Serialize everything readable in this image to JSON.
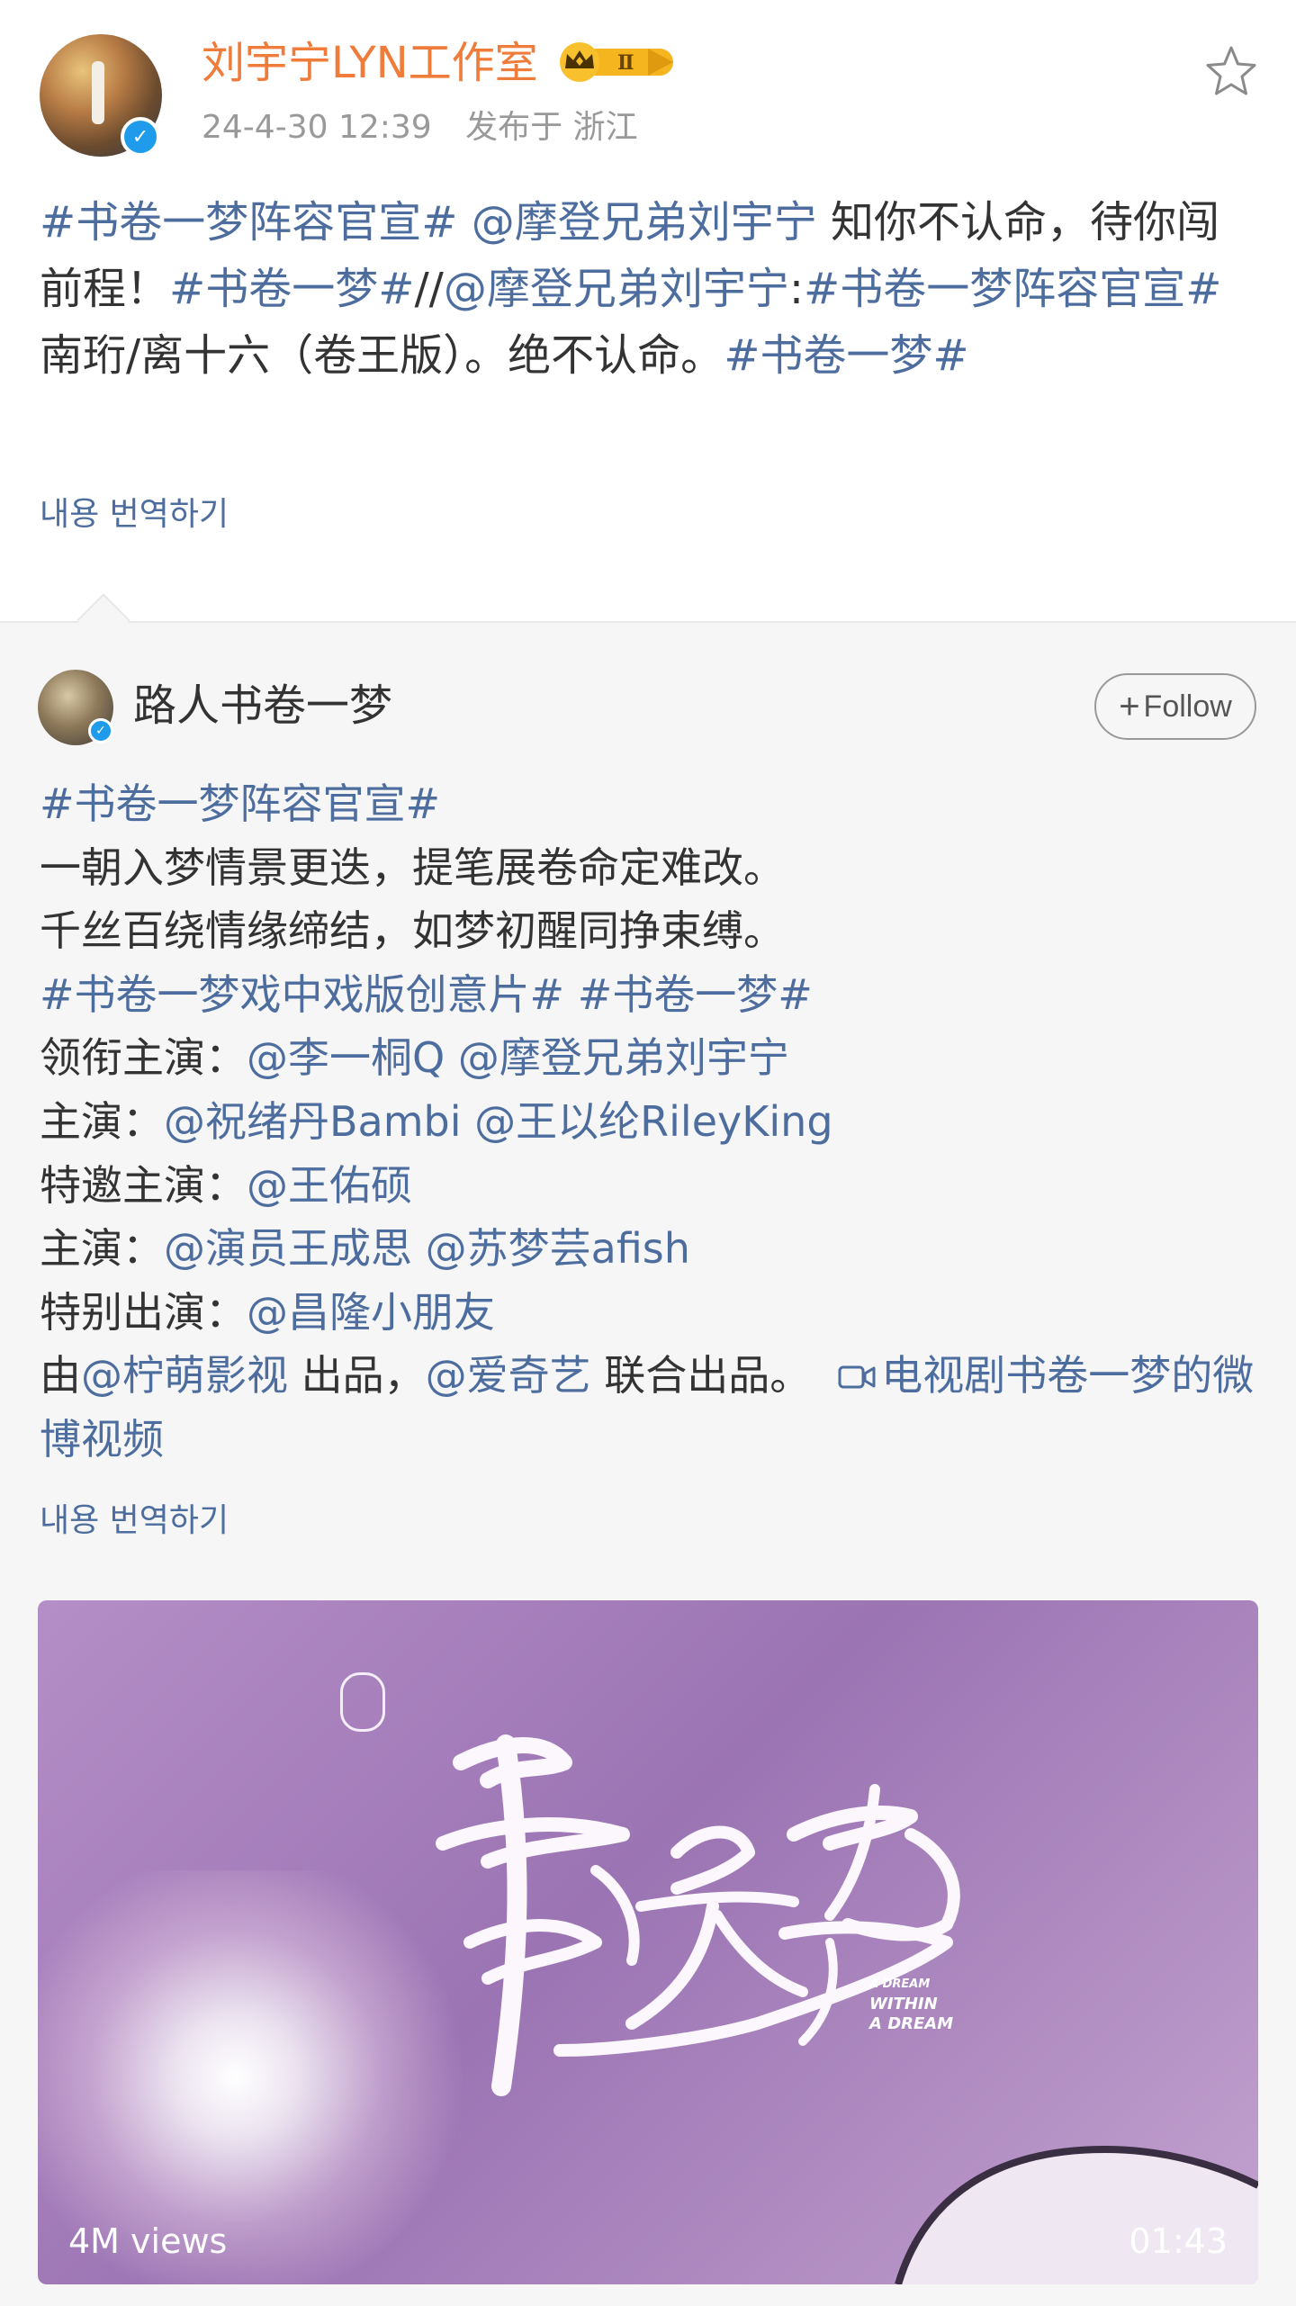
{
  "post": {
    "author": "刘宇宁LYN工作室",
    "badge": "Ⅱ",
    "timestamp": "24-4-30 12:39",
    "location": "发布于 浙江",
    "text_parts": [
      {
        "t": "#书卷一梦阵容官宣#",
        "link": true
      },
      {
        "t": " ",
        "link": false
      },
      {
        "t": "@摩登兄弟刘宇宁",
        "link": true
      },
      {
        "t": " 知你不认命，待你闯前程！",
        "link": false
      },
      {
        "t": "#书卷一梦#",
        "link": true
      },
      {
        "t": "//",
        "link": false
      },
      {
        "t": "@摩登兄弟刘宇宁",
        "link": true
      },
      {
        "t": ":",
        "link": false
      },
      {
        "t": "#书卷一梦阵容官宣#",
        "link": true
      },
      {
        "t": " 南珩/离十六（卷王版）。绝不认命。",
        "link": false
      },
      {
        "t": "#书卷一梦#",
        "link": true
      }
    ],
    "translate": "내용 번역하기"
  },
  "repost": {
    "author": "路人书卷一梦",
    "follow_label": "Follow",
    "lines": [
      [
        {
          "t": "#书卷一梦阵容官宣#",
          "link": true
        }
      ],
      [
        {
          "t": "一朝入梦情景更迭，提笔展卷命定难改。",
          "link": false
        }
      ],
      [
        {
          "t": "千丝百绕情缘缔结，如梦初醒同挣束缚。",
          "link": false
        }
      ],
      [
        {
          "t": "#书卷一梦戏中戏版创意片#",
          "link": true
        },
        {
          "t": " ",
          "link": false
        },
        {
          "t": "#书卷一梦#",
          "link": true
        }
      ],
      [
        {
          "t": "领衔主演：",
          "link": false
        },
        {
          "t": "@李一桐Q",
          "link": true
        },
        {
          "t": " ",
          "link": false
        },
        {
          "t": "@摩登兄弟刘宇宁",
          "link": true
        }
      ],
      [
        {
          "t": "主演：",
          "link": false
        },
        {
          "t": "@祝绪丹Bambi",
          "link": true
        },
        {
          "t": " ",
          "link": false
        },
        {
          "t": "@王以纶RileyKing",
          "link": true
        }
      ],
      [
        {
          "t": "特邀主演：",
          "link": false
        },
        {
          "t": "@王佑硕",
          "link": true
        }
      ],
      [
        {
          "t": "主演：",
          "link": false
        },
        {
          "t": "@演员王成思",
          "link": true
        },
        {
          "t": " ",
          "link": false
        },
        {
          "t": "@苏梦芸afish",
          "link": true
        }
      ],
      [
        {
          "t": "特别出演：",
          "link": false
        },
        {
          "t": "@昌隆小朋友",
          "link": true
        }
      ]
    ],
    "last_line": {
      "a": "由",
      "b": "@柠萌影视",
      "c": " 出品，",
      "d": "@爱奇艺",
      "e": " 联合出品。",
      "video_link": "电视剧书卷一梦的微博视频"
    },
    "translate": "내용 번역하기",
    "video": {
      "views": "4M views",
      "duration": "01:43",
      "subtitle_lines": [
        "A DREAM",
        "WITHIN",
        "A DREAM"
      ]
    }
  },
  "colors": {
    "link": "#4d6d9f",
    "author": "#f07c3b",
    "meta": "#999999",
    "verified": "#1e9ceb",
    "repost_bg": "#f6f6f6"
  },
  "icons": [
    "verified-icon",
    "vip-crown-icon",
    "star-icon",
    "video-camera-icon",
    "plus-icon"
  ]
}
